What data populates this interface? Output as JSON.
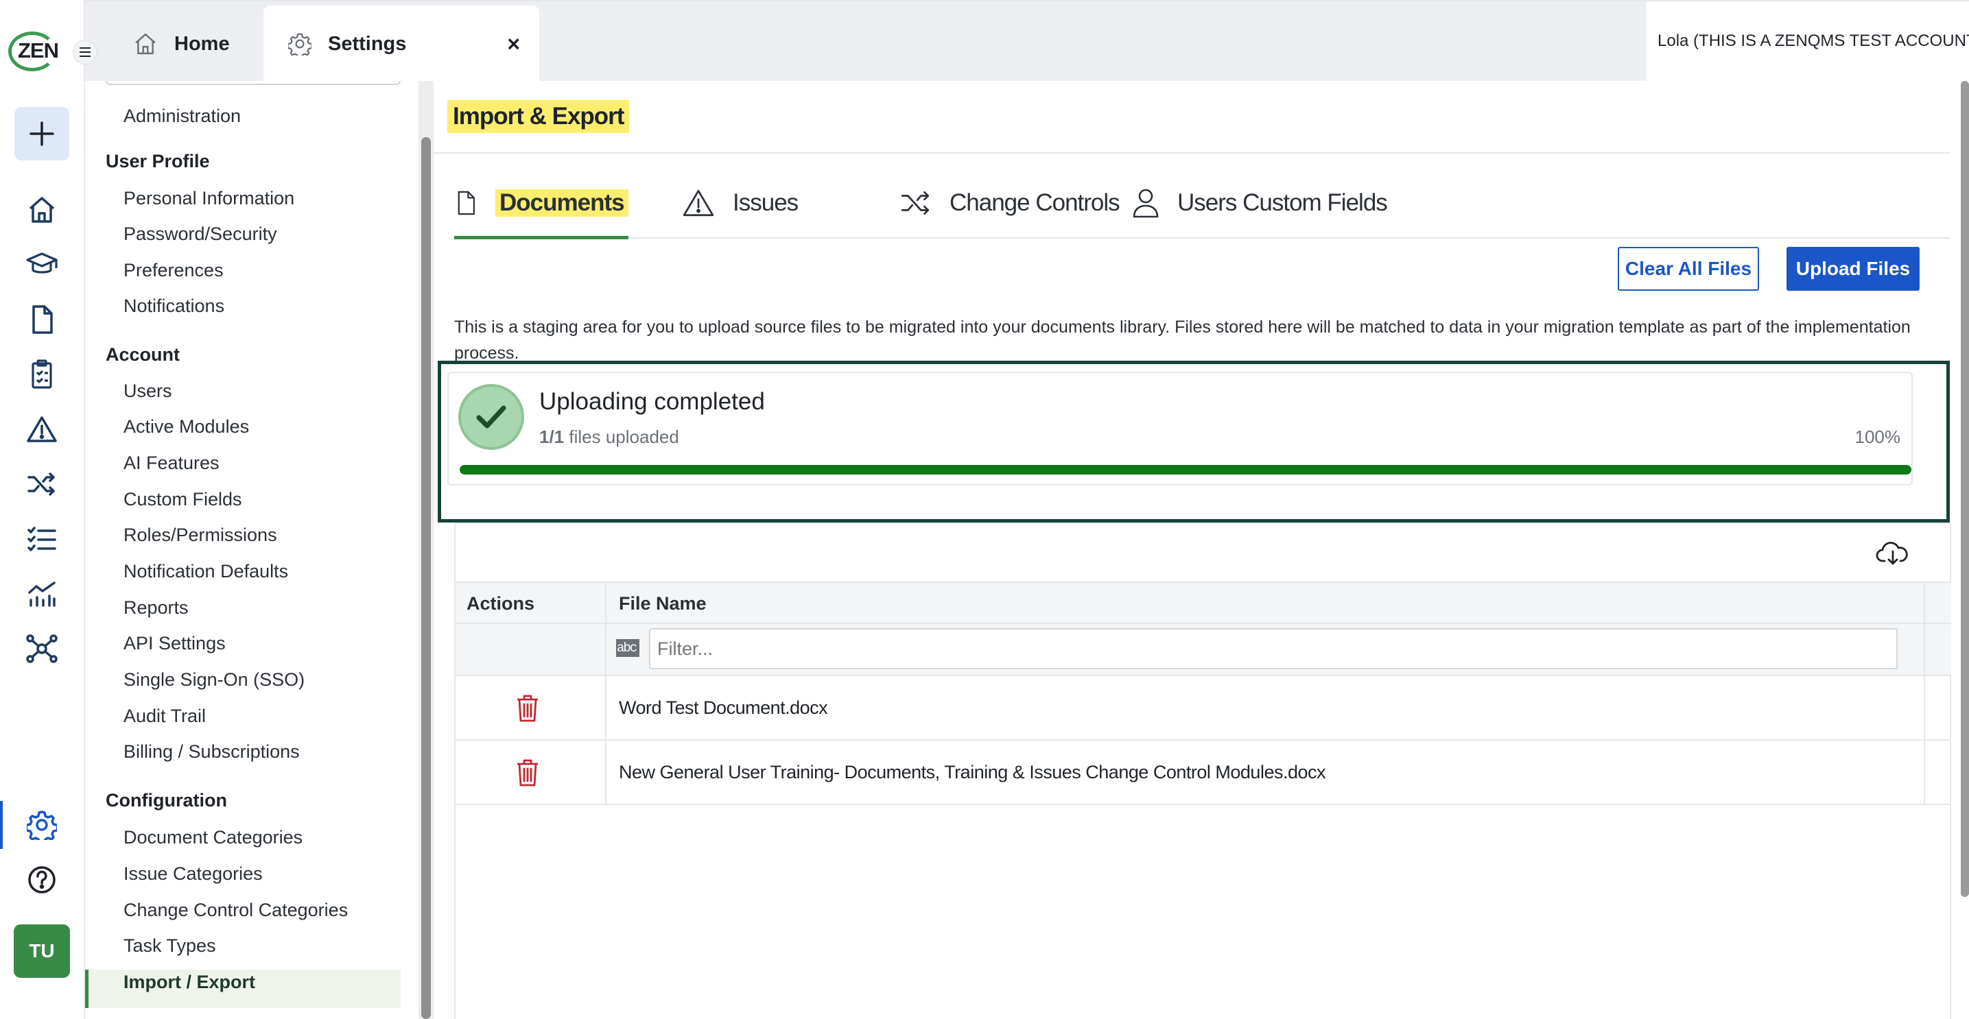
{
  "app": {
    "logo_text": "ZEN"
  },
  "rail": {
    "icons": [
      "home-icon",
      "training-icon",
      "document-icon",
      "clipboard-icon",
      "warning-icon",
      "shuffle-icon",
      "task-list-icon",
      "analytics-icon",
      "network-icon",
      "gear-icon",
      "help-icon"
    ],
    "active": "gear-icon",
    "avatar_initials": "TU",
    "accent_color": "#1a56c7",
    "brand_color": "#3a8a47"
  },
  "tabs": [
    {
      "label": "Home",
      "icon": "home-icon"
    },
    {
      "label": "Settings",
      "icon": "gear-icon",
      "active": true,
      "close": "×"
    }
  ],
  "account": {
    "label": "Lola (THIS IS A ZENQMS TEST ACCOUNT)"
  },
  "sidenav": {
    "items": [
      {
        "type": "item",
        "label": "Administration"
      },
      {
        "type": "group",
        "label": "User Profile"
      },
      {
        "type": "item",
        "label": "Personal Information"
      },
      {
        "type": "item",
        "label": "Password/Security"
      },
      {
        "type": "item",
        "label": "Preferences"
      },
      {
        "type": "item",
        "label": "Notifications"
      },
      {
        "type": "group",
        "label": "Account"
      },
      {
        "type": "item",
        "label": "Users"
      },
      {
        "type": "item",
        "label": "Active Modules"
      },
      {
        "type": "item",
        "label": "AI Features"
      },
      {
        "type": "item",
        "label": "Custom Fields"
      },
      {
        "type": "item",
        "label": "Roles/Permissions"
      },
      {
        "type": "item",
        "label": "Notification Defaults"
      },
      {
        "type": "item",
        "label": "Reports"
      },
      {
        "type": "item",
        "label": "API Settings"
      },
      {
        "type": "item",
        "label": "Single Sign-On (SSO)"
      },
      {
        "type": "item",
        "label": "Audit Trail"
      },
      {
        "type": "item",
        "label": "Billing / Subscriptions"
      },
      {
        "type": "group",
        "label": "Configuration"
      },
      {
        "type": "item",
        "label": "Document Categories"
      },
      {
        "type": "item",
        "label": "Issue Categories"
      },
      {
        "type": "item",
        "label": "Change Control Categories"
      },
      {
        "type": "item",
        "label": "Task Types"
      },
      {
        "type": "item",
        "label": "Import / Export",
        "active": true
      }
    ]
  },
  "main": {
    "title": "Import & Export",
    "tabs": [
      {
        "label": "Documents",
        "icon": "document-icon",
        "active": true
      },
      {
        "label": "Issues",
        "icon": "warning-icon"
      },
      {
        "label": "Change Controls",
        "icon": "shuffle-icon"
      },
      {
        "label": "Users Custom Fields",
        "icon": "user-icon"
      }
    ],
    "buttons": {
      "clear_all": "Clear All Files",
      "upload": "Upload Files"
    },
    "description": "This is a staging area for you to upload source files to be migrated into your documents library. Files stored here will be matched to data in your migration template as part of the implementation process.",
    "upload_status": {
      "title": "Uploading completed",
      "count": "1/1",
      "count_suffix": " files uploaded",
      "percent_label": "100%",
      "progress": 1.0,
      "progress_color": "#0f7a17"
    },
    "grid": {
      "columns": [
        "Actions",
        "File Name"
      ],
      "filter_icon": "abc",
      "filter_placeholder": "Filter...",
      "rows": [
        {
          "file_name": "Word Test Document.docx"
        },
        {
          "file_name": "New General User Training- Documents, Training & Issues Change Control Modules.docx"
        }
      ]
    }
  }
}
